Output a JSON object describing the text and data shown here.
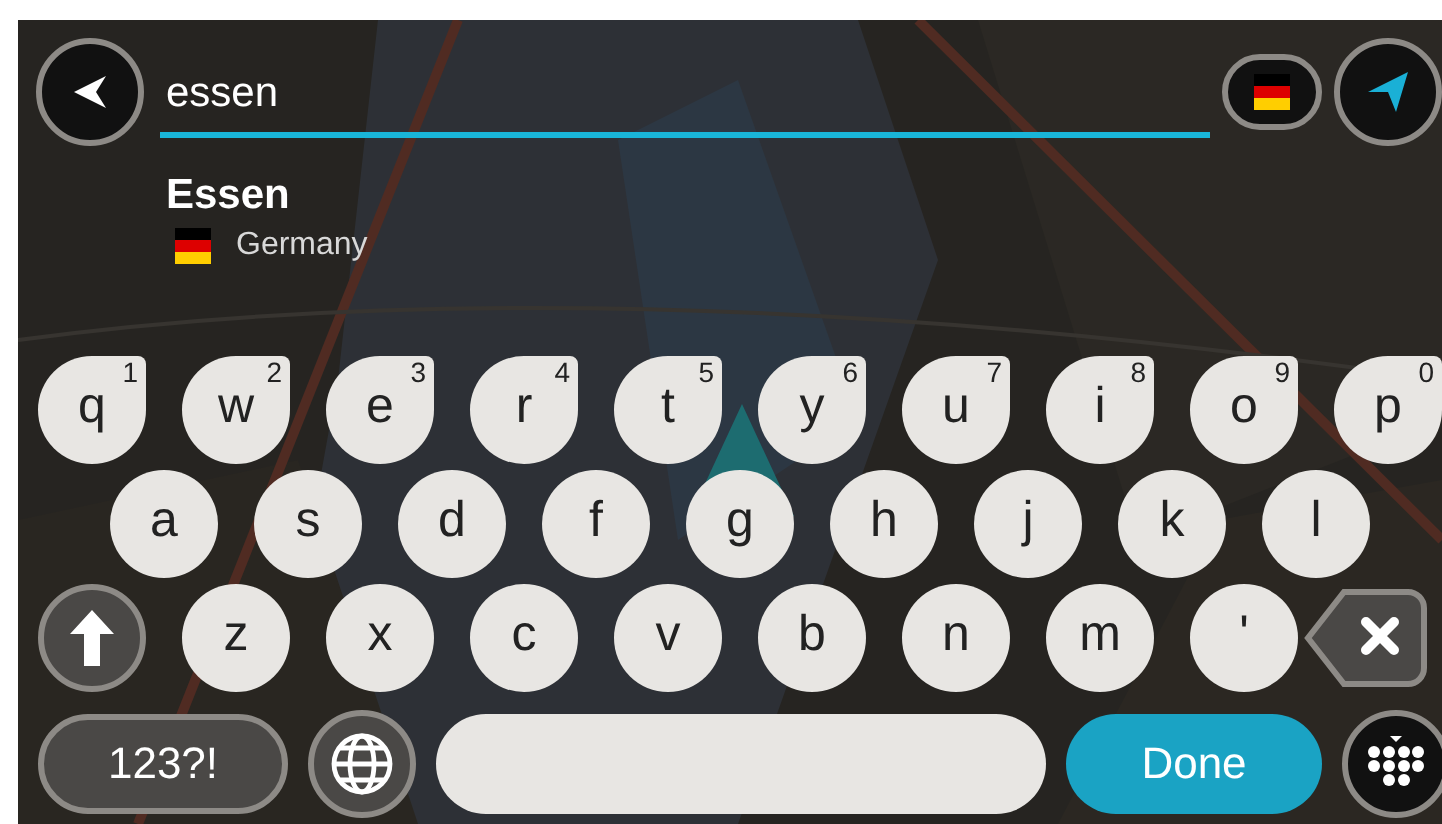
{
  "search": {
    "value": "essen"
  },
  "results": [
    {
      "title": "Essen",
      "country": "Germany"
    }
  ],
  "keyboard": {
    "rows": [
      [
        {
          "kind": "letter",
          "label": "q",
          "digit": "1"
        },
        {
          "kind": "letter",
          "label": "w",
          "digit": "2"
        },
        {
          "kind": "letter",
          "label": "e",
          "digit": "3"
        },
        {
          "kind": "letter",
          "label": "r",
          "digit": "4"
        },
        {
          "kind": "letter",
          "label": "t",
          "digit": "5"
        },
        {
          "kind": "letter",
          "label": "y",
          "digit": "6"
        },
        {
          "kind": "letter",
          "label": "u",
          "digit": "7"
        },
        {
          "kind": "letter",
          "label": "i",
          "digit": "8"
        },
        {
          "kind": "letter",
          "label": "o",
          "digit": "9"
        },
        {
          "kind": "letter",
          "label": "p",
          "digit": "0"
        }
      ],
      [
        {
          "kind": "letter",
          "label": "a"
        },
        {
          "kind": "letter",
          "label": "s"
        },
        {
          "kind": "letter",
          "label": "d"
        },
        {
          "kind": "letter",
          "label": "f"
        },
        {
          "kind": "letter",
          "label": "g"
        },
        {
          "kind": "letter",
          "label": "h"
        },
        {
          "kind": "letter",
          "label": "j"
        },
        {
          "kind": "letter",
          "label": "k"
        },
        {
          "kind": "letter",
          "label": "l"
        }
      ],
      [
        {
          "kind": "shift"
        },
        {
          "kind": "letter",
          "label": "z"
        },
        {
          "kind": "letter",
          "label": "x"
        },
        {
          "kind": "letter",
          "label": "c"
        },
        {
          "kind": "letter",
          "label": "v"
        },
        {
          "kind": "letter",
          "label": "b"
        },
        {
          "kind": "letter",
          "label": "n"
        },
        {
          "kind": "letter",
          "label": "m"
        },
        {
          "kind": "letter",
          "label": "'"
        },
        {
          "kind": "backspace"
        }
      ],
      [
        {
          "kind": "symbols",
          "label": "123?!"
        },
        {
          "kind": "globe"
        },
        {
          "kind": "space"
        },
        {
          "kind": "done",
          "label": "Done"
        },
        {
          "kind": "hide"
        }
      ]
    ]
  }
}
